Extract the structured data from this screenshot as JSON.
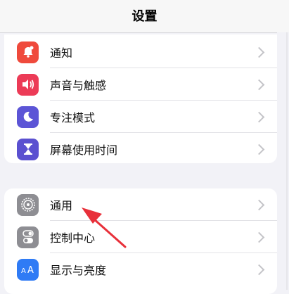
{
  "header": {
    "title": "设置"
  },
  "groups": [
    {
      "items": [
        {
          "label": "通知",
          "icon": "bell-icon",
          "color": "#ef4a3c"
        },
        {
          "label": "声音与触感",
          "icon": "speaker-icon",
          "color": "#ec3b57"
        },
        {
          "label": "专注模式",
          "icon": "moon-icon",
          "color": "#5c55d6"
        },
        {
          "label": "屏幕使用时间",
          "icon": "hourglass-icon",
          "color": "#5a50d0"
        }
      ]
    },
    {
      "items": [
        {
          "label": "通用",
          "icon": "gear-icon",
          "color": "#8e8e93"
        },
        {
          "label": "控制中心",
          "icon": "toggles-icon",
          "color": "#8e8e93"
        },
        {
          "label": "显示与亮度",
          "icon": "text-size-icon",
          "color": "#2f7bf5"
        }
      ]
    }
  ],
  "annotation": {
    "type": "red-arrow",
    "color": "#e8303a",
    "target": "通用"
  }
}
